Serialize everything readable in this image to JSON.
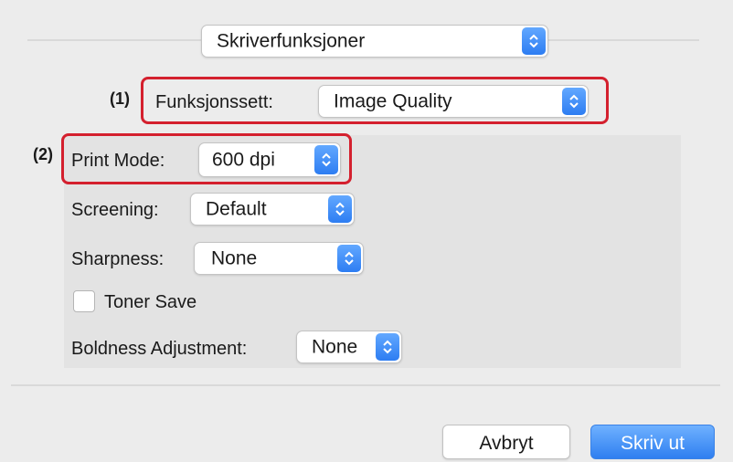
{
  "menu_popup": {
    "value": "Skriverfunksjoner"
  },
  "callouts": {
    "one": "(1)",
    "two": "(2)"
  },
  "feature_set": {
    "label": "Funksjonssett:",
    "value": "Image Quality"
  },
  "print_mode": {
    "label": "Print Mode:",
    "value": "600 dpi"
  },
  "screening": {
    "label": "Screening:",
    "value": "Default"
  },
  "sharpness": {
    "label": "Sharpness:",
    "value": "None"
  },
  "toner_save": {
    "label": "Toner Save",
    "checked": false
  },
  "boldness": {
    "label": "Boldness Adjustment:",
    "value": "None"
  },
  "buttons": {
    "cancel": "Avbryt",
    "print": "Skriv ut"
  },
  "colors": {
    "accent": "#2f7ff0",
    "highlight": "#d4202e",
    "panel": "#e3e3e3"
  }
}
